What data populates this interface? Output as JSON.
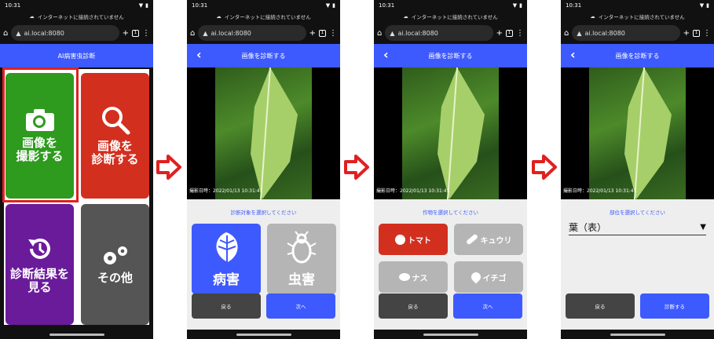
{
  "status": {
    "time": "10:31"
  },
  "notice": "インターネットに接続されていません",
  "browser": {
    "url": "ai.local:8080",
    "tabs": "1"
  },
  "screen1": {
    "title": "AI病害虫診断",
    "tiles": [
      {
        "label": "画像を\n撮影する",
        "color": "#2e9a1e",
        "icon": "camera-icon"
      },
      {
        "label": "画像を\n診断する",
        "color": "#d32f1f",
        "icon": "magnifier-icon"
      },
      {
        "label": "診断結果を\n見る",
        "color": "#6a1b9a",
        "icon": "history-icon"
      },
      {
        "label": "その他",
        "color": "#555555",
        "icon": "gears-icon"
      }
    ]
  },
  "diag": {
    "title": "画像を診断する",
    "photo_stamp": "撮影日時：2022/01/13 10:31:41"
  },
  "screen2": {
    "prompt": "診断対象を選択してください",
    "options": [
      {
        "label": "病害",
        "color": "#3d5afe",
        "icon": "leaf-icon"
      },
      {
        "label": "虫害",
        "color": "#b5b5b5",
        "icon": "bug-icon"
      }
    ],
    "back": "戻る",
    "next": "次へ"
  },
  "screen3": {
    "prompt": "作物を選択してください",
    "crops": [
      {
        "label": "トマト",
        "color": "#d32f1f",
        "icon": "tomato-icon"
      },
      {
        "label": "キュウリ",
        "color": "#b5b5b5",
        "icon": "cucumber-icon"
      },
      {
        "label": "ナス",
        "color": "#b5b5b5",
        "icon": "eggplant-icon"
      },
      {
        "label": "イチゴ",
        "color": "#b5b5b5",
        "icon": "strawberry-icon"
      }
    ],
    "back": "戻る",
    "next": "次へ"
  },
  "screen4": {
    "prompt": "部位を選択してください",
    "part_value": "葉（表）",
    "back": "戻る",
    "submit": "診断する"
  },
  "colors": {
    "accent": "#3d5afe",
    "dark_btn": "#444444",
    "highlight": "#e02020"
  }
}
